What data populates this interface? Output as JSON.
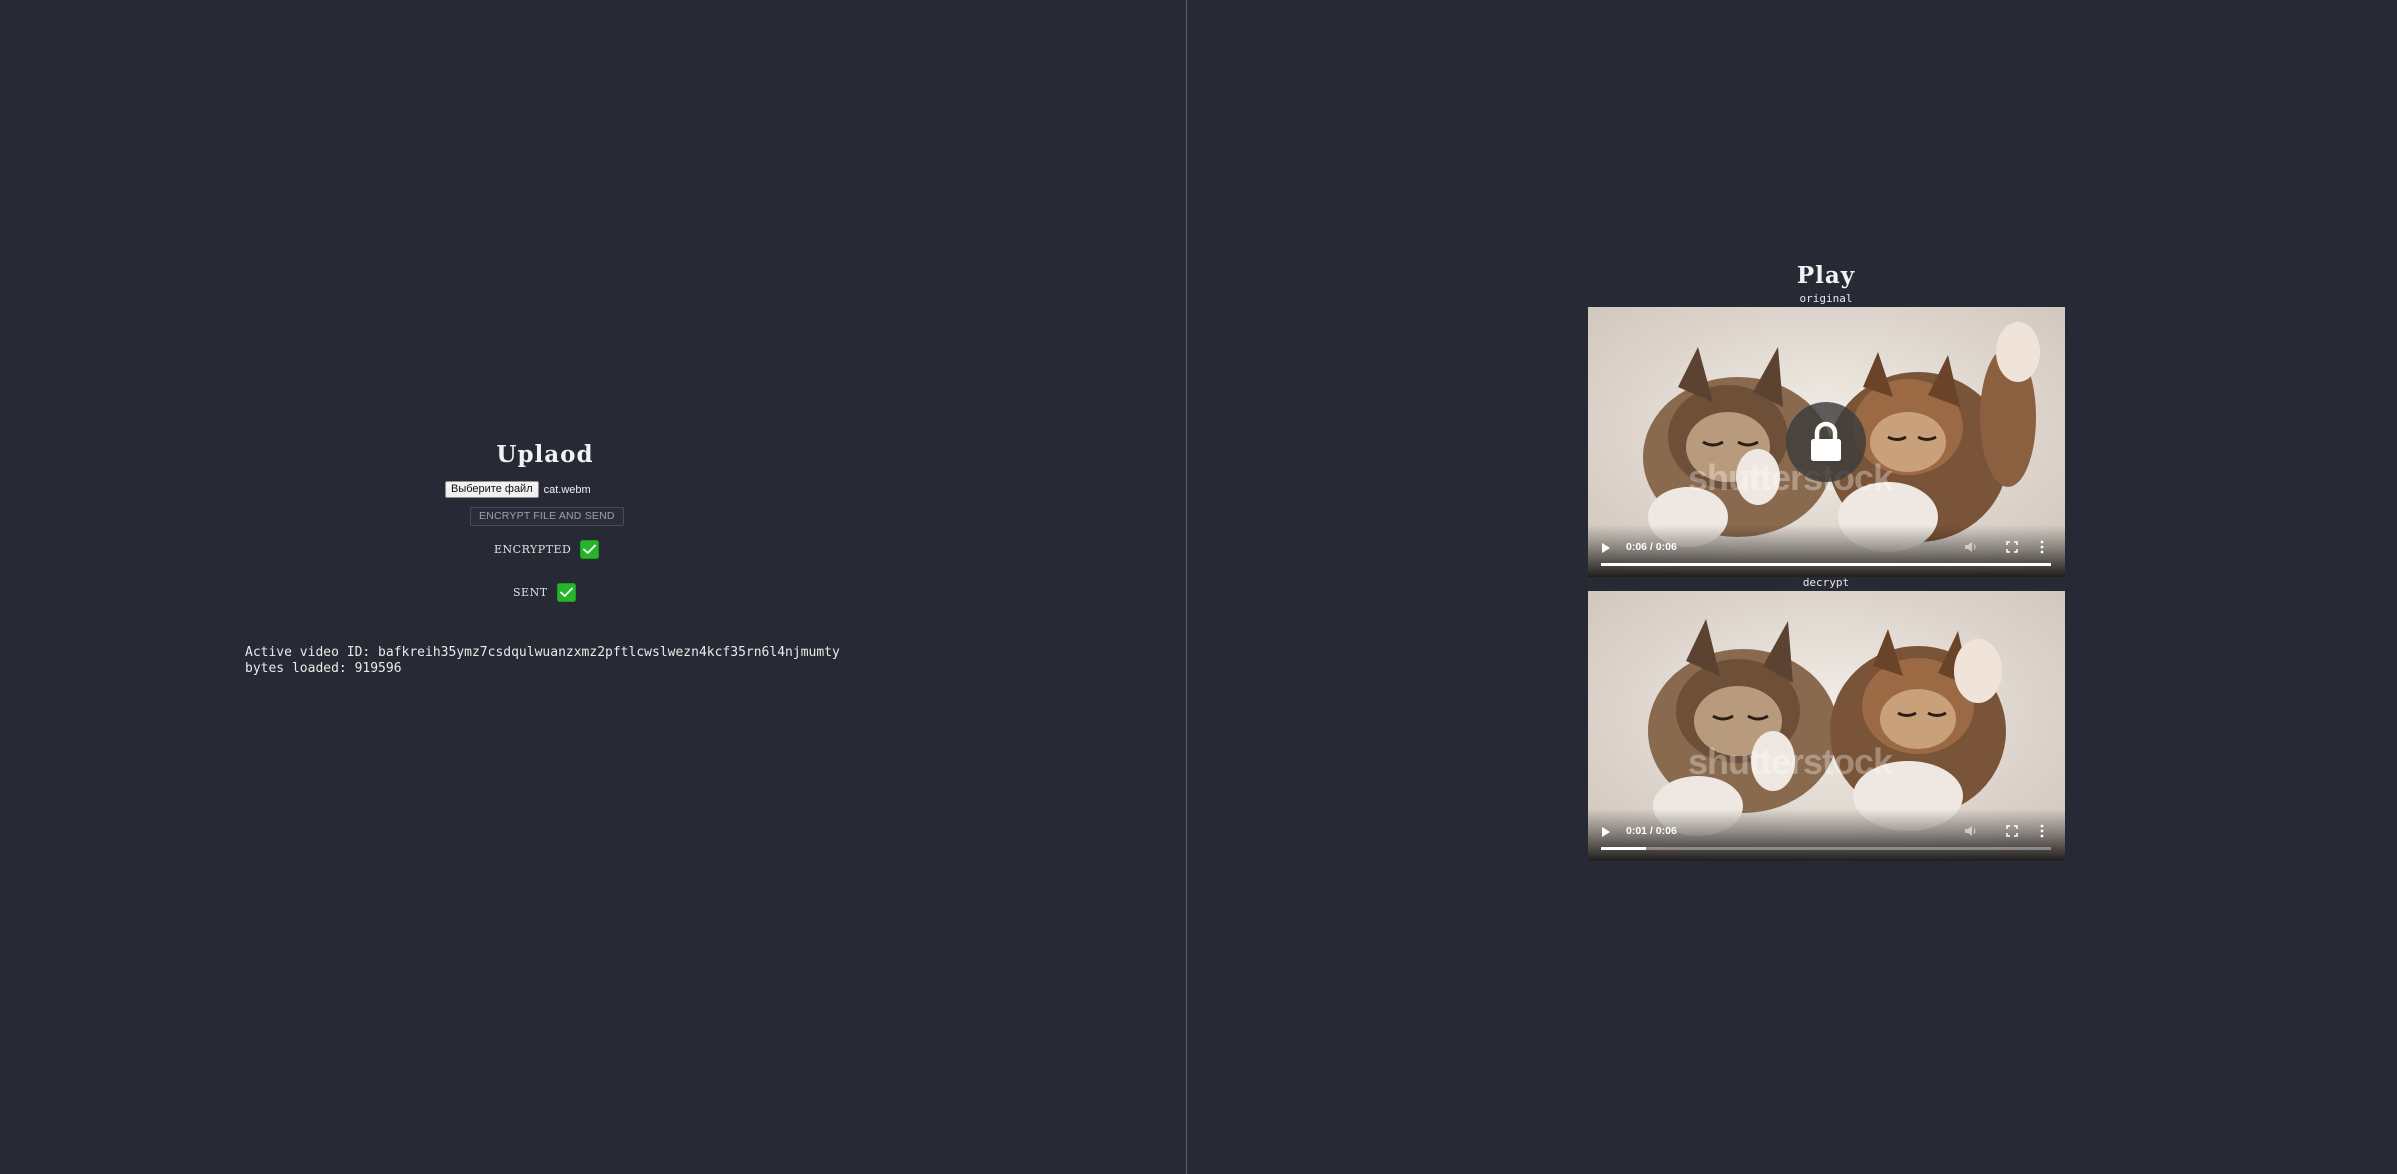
{
  "upload": {
    "title": "Uplaod",
    "file_button_label": "Выберите файл",
    "file_name": "cat.webm",
    "encrypt_button_label": "ENCRYPT FILE AND SEND",
    "encrypted_label": "ENCRYPTED",
    "sent_label": "SENT",
    "active_video_line": "Active video ID: bafkreih35ymz7csdqulwuanzxmz2pftlcwslwezn4kcf35rn6l4njmumty",
    "bytes_loaded_line": "bytes loaded: 919596"
  },
  "play": {
    "title": "Play",
    "original_caption": "original",
    "decrypt_caption": "decrypt",
    "original_video": {
      "time": "0:06 / 0:06",
      "progress": 1.0,
      "locked": true,
      "watermark": "shutterstock"
    },
    "decrypt_video": {
      "time": "0:01 / 0:06",
      "progress": 0.1,
      "locked": false,
      "watermark": "shutterstock"
    }
  },
  "icons": {
    "play": "play-icon",
    "volume": "volume-icon",
    "fullscreen": "fullscreen-icon",
    "more": "more-vertical-icon",
    "lock": "lock-icon",
    "check": "checkmark-icon"
  },
  "colors": {
    "background": "#272a35",
    "check_green": "#25b52a",
    "divider": "#5a5d68"
  }
}
